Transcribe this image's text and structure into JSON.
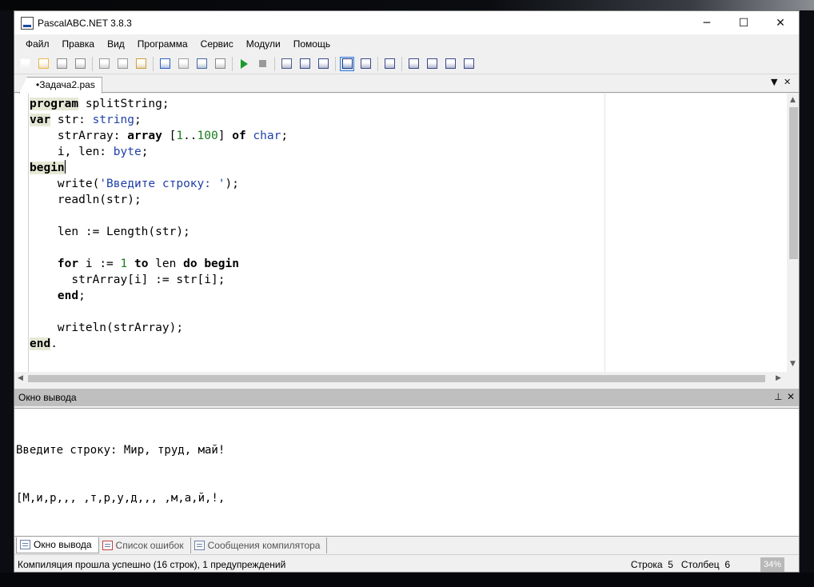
{
  "window": {
    "title": "PascalABC.NET 3.8.3",
    "icon_text": "AB\nabc",
    "controls": {
      "minimize": "─",
      "maximize": "☐",
      "close": "✕"
    }
  },
  "menu": [
    "Файл",
    "Правка",
    "Вид",
    "Программа",
    "Сервис",
    "Модули",
    "Помощь"
  ],
  "toolbar": {
    "buttons": [
      {
        "icon": "new-file-icon",
        "color": "#f4f4f4"
      },
      {
        "icon": "open-folder-icon",
        "color": "#e8b84a"
      },
      {
        "icon": "save-icon",
        "color": "#8a8a8a"
      },
      {
        "icon": "save-all-icon",
        "color": "#8a8a8a"
      },
      {
        "icon": "cut-icon",
        "color": "#9a9a9a"
      },
      {
        "icon": "copy-icon",
        "color": "#9a9a9a"
      },
      {
        "icon": "paste-icon",
        "color": "#c8a040"
      },
      {
        "icon": "undo-icon",
        "color": "#3060c0"
      },
      {
        "icon": "redo-icon",
        "color": "#a0a0a0"
      },
      {
        "icon": "find-icon",
        "color": "#4a6aa0"
      },
      {
        "icon": "replace-icon",
        "color": "#8a8a8a"
      },
      {
        "icon": "run-icon",
        "color": "#1a9a2a"
      },
      {
        "icon": "stop-icon",
        "color": "#9a9a9a"
      },
      {
        "icon": "compile-icon",
        "color": "#4a5a8a"
      },
      {
        "icon": "step-into-icon",
        "color": "#3a4a8a"
      },
      {
        "icon": "step-over-icon",
        "color": "#3a4a8a"
      },
      {
        "icon": "console-icon",
        "color": "#2a3a7a",
        "active": true
      },
      {
        "icon": "format-code-icon",
        "color": "#3a4a8a"
      },
      {
        "icon": "form-designer-icon",
        "color": "#3a4a8a"
      },
      {
        "icon": "code-template-icon",
        "color": "#3a4a8a"
      },
      {
        "icon": "module-icon",
        "color": "#3a4a8a"
      },
      {
        "icon": "library-icon",
        "color": "#3a4a8a"
      },
      {
        "icon": "reference-icon",
        "color": "#3a4a8a"
      }
    ]
  },
  "doc_tab": {
    "label": "•Задача2.pas",
    "dropdown": "▼",
    "close": "✕"
  },
  "code": [
    [
      {
        "t": "program",
        "c": "kw-hl"
      },
      {
        "t": " splitString;"
      }
    ],
    [
      {
        "t": "var",
        "c": "kw-hl"
      },
      {
        "t": " str: "
      },
      {
        "t": "string",
        "c": "ty"
      },
      {
        "t": ";"
      }
    ],
    [
      {
        "t": "    strArray: "
      },
      {
        "t": "array",
        "c": "kw"
      },
      {
        "t": " ["
      },
      {
        "t": "1",
        "c": "num"
      },
      {
        "t": ".."
      },
      {
        "t": "100",
        "c": "num"
      },
      {
        "t": "] "
      },
      {
        "t": "of",
        "c": "kw"
      },
      {
        "t": " "
      },
      {
        "t": "char",
        "c": "ty"
      },
      {
        "t": ";"
      }
    ],
    [
      {
        "t": "    i, len: "
      },
      {
        "t": "byte",
        "c": "ty"
      },
      {
        "t": ";"
      }
    ],
    [
      {
        "t": "begin",
        "c": "kw-hl"
      },
      {
        "t": "",
        "caret": true
      }
    ],
    [
      {
        "t": "    write("
      },
      {
        "t": "'Введите строку: '",
        "c": "str"
      },
      {
        "t": ");"
      }
    ],
    [
      {
        "t": "    readln(str);"
      }
    ],
    [
      {
        "t": ""
      }
    ],
    [
      {
        "t": "    len := Length(str);"
      }
    ],
    [
      {
        "t": ""
      }
    ],
    [
      {
        "t": "    "
      },
      {
        "t": "for",
        "c": "kw"
      },
      {
        "t": " i := "
      },
      {
        "t": "1",
        "c": "num"
      },
      {
        "t": " "
      },
      {
        "t": "to",
        "c": "kw"
      },
      {
        "t": " len "
      },
      {
        "t": "do",
        "c": "kw"
      },
      {
        "t": " "
      },
      {
        "t": "begin",
        "c": "kw"
      }
    ],
    [
      {
        "t": "      strArray[i] := str[i];"
      }
    ],
    [
      {
        "t": "    "
      },
      {
        "t": "end",
        "c": "kw"
      },
      {
        "t": ";"
      }
    ],
    [
      {
        "t": ""
      }
    ],
    [
      {
        "t": "    writeln(strArray);"
      }
    ],
    [
      {
        "t": "end",
        "c": "kw-hl"
      },
      {
        "t": "."
      }
    ]
  ],
  "scroll": {
    "up": "▲",
    "down": "▼",
    "left": "◀",
    "right": "▶"
  },
  "output_panel": {
    "title": "Окно вывода",
    "pin": "⊥",
    "close": "✕",
    "lines": [
      "Введите строку: Мир, труд, май!",
      "[М,и,р,,, ,т,р,у,д,,, ,м,а,й,!,"
    ]
  },
  "bottom_tabs": [
    {
      "label": "Окно вывода",
      "active": true
    },
    {
      "label": "Список ошибок",
      "active": false
    },
    {
      "label": "Сообщения компилятора",
      "active": false
    }
  ],
  "status": {
    "message": "Компиляция прошла успешно (16 строк), 1 предупреждений",
    "position": "Строка  5   Столбец  6",
    "zoom": "34%"
  }
}
